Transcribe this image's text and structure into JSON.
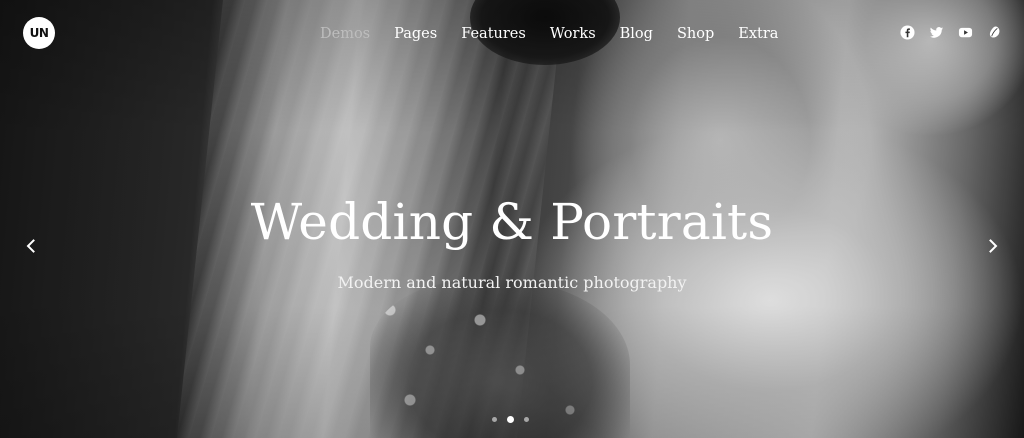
{
  "brand": {
    "logo_text": "UN"
  },
  "nav": {
    "items": [
      {
        "label": "Demos",
        "active": true
      },
      {
        "label": "Pages",
        "active": false
      },
      {
        "label": "Features",
        "active": false
      },
      {
        "label": "Works",
        "active": false
      },
      {
        "label": "Blog",
        "active": false
      },
      {
        "label": "Shop",
        "active": false
      },
      {
        "label": "Extra",
        "active": false
      }
    ]
  },
  "social": [
    "facebook-icon",
    "twitter-icon",
    "youtube-icon",
    "dribbble-icon"
  ],
  "hero": {
    "title": "Wedding & Portraits",
    "subtitle": "Modern and natural romantic photography",
    "slide_count": 3,
    "active_slide": 2
  },
  "colors": {
    "text": "#ffffff",
    "nav_active": "#bdbdbd",
    "logo_bg": "#ffffff",
    "logo_text": "#111111"
  }
}
